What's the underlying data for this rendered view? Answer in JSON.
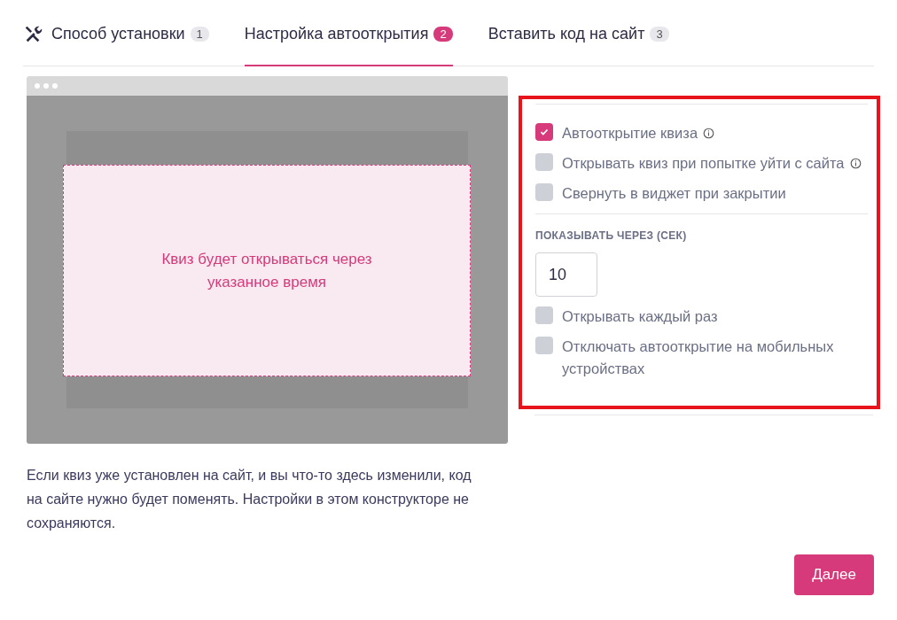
{
  "tabs": [
    {
      "label": "Способ установки",
      "badge": "1",
      "selected": false,
      "icon": true
    },
    {
      "label": "Настройка автооткрытия",
      "badge": "2",
      "selected": true,
      "icon": false
    },
    {
      "label": "Вставить код на сайт",
      "badge": "3",
      "selected": false,
      "icon": false
    }
  ],
  "preview": {
    "message": "Квиз будет открываться через указанное время"
  },
  "options_top": [
    {
      "label": "Автооткрытие квиза",
      "checked": true,
      "info": true
    },
    {
      "label": "Открывать квиз при попытке уйти с сайта",
      "checked": false,
      "info": true
    },
    {
      "label": "Свернуть в виджет при закрытии",
      "checked": false
    }
  ],
  "delay": {
    "label": "ПОКАЗЫВАТЬ ЧЕРЕЗ (СЕК)",
    "value": "10"
  },
  "options_bottom": [
    {
      "label": "Открывать каждый раз",
      "checked": false
    },
    {
      "label": "Отключать автооткрытие на мобильных устройствах",
      "checked": false
    }
  ],
  "note": "Если квиз уже установлен на сайт, и вы что-то здесь изменили, код на сайте нужно будет поменять. Настройки в этом конструкторе не сохраняются.",
  "next_button": "Далее"
}
